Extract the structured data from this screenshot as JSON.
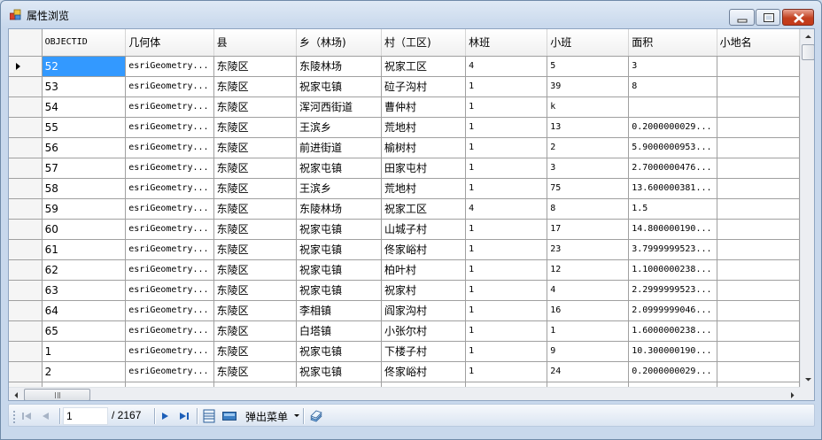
{
  "window": {
    "title": "属性浏览",
    "min_icon": "minimize-icon",
    "max_icon": "maximize-icon",
    "close_icon": "close-icon"
  },
  "grid": {
    "columns": [
      "OBJECTID",
      "几何体",
      "县",
      "乡（林场)",
      "村（工区)",
      "林班",
      "小班",
      "面积",
      "小地名"
    ],
    "selected_row": 0,
    "rows": [
      [
        "52",
        "esriGeometry...",
        "东陵区",
        "东陵林场",
        "祝家工区",
        "4",
        "5",
        "3",
        ""
      ],
      [
        "53",
        "esriGeometry...",
        "东陵区",
        "祝家屯镇",
        "砬子沟村",
        "1",
        "39",
        "8",
        ""
      ],
      [
        "54",
        "esriGeometry...",
        "东陵区",
        "浑河西街道",
        "曹仲村",
        "1",
        "k",
        "",
        ""
      ],
      [
        "55",
        "esriGeometry...",
        "东陵区",
        "王滨乡",
        "荒地村",
        "1",
        "13",
        "0.2000000029...",
        ""
      ],
      [
        "56",
        "esriGeometry...",
        "东陵区",
        "前进街道",
        "榆树村",
        "1",
        "2",
        "5.9000000953...",
        ""
      ],
      [
        "57",
        "esriGeometry...",
        "东陵区",
        "祝家屯镇",
        "田家屯村",
        "1",
        "3",
        "2.7000000476...",
        ""
      ],
      [
        "58",
        "esriGeometry...",
        "东陵区",
        "王滨乡",
        "荒地村",
        "1",
        "75",
        "13.600000381...",
        ""
      ],
      [
        "59",
        "esriGeometry...",
        "东陵区",
        "东陵林场",
        "祝家工区",
        "4",
        "8",
        "1.5",
        ""
      ],
      [
        "60",
        "esriGeometry...",
        "东陵区",
        "祝家屯镇",
        "山城子村",
        "1",
        "17",
        "14.800000190...",
        ""
      ],
      [
        "61",
        "esriGeometry...",
        "东陵区",
        "祝家屯镇",
        "佟家峪村",
        "1",
        "23",
        "3.7999999523...",
        ""
      ],
      [
        "62",
        "esriGeometry...",
        "东陵区",
        "祝家屯镇",
        "柏叶村",
        "1",
        "12",
        "1.1000000238...",
        ""
      ],
      [
        "63",
        "esriGeometry...",
        "东陵区",
        "祝家屯镇",
        "祝家村",
        "1",
        "4",
        "2.2999999523...",
        ""
      ],
      [
        "64",
        "esriGeometry...",
        "东陵区",
        "李相镇",
        "阎家沟村",
        "1",
        "16",
        "2.0999999046...",
        ""
      ],
      [
        "65",
        "esriGeometry...",
        "东陵区",
        "白塔镇",
        "小张尔村",
        "1",
        "1",
        "1.6000000238...",
        ""
      ],
      [
        "1",
        "esriGeometry...",
        "东陵区",
        "祝家屯镇",
        "下楼子村",
        "1",
        "9",
        "10.300000190...",
        ""
      ],
      [
        "2",
        "esriGeometry...",
        "东陵区",
        "祝家屯镇",
        "佟家峪村",
        "1",
        "24",
        "0.2000000029...",
        ""
      ],
      [
        "",
        "",
        "",
        "",
        "",
        "",
        "",
        "",
        ""
      ]
    ]
  },
  "navigator": {
    "position": "1",
    "count_label": "/ 2167",
    "menu_label": "弹出菜单",
    "icons": [
      "first-record-icon",
      "previous-record-icon",
      "next-record-icon",
      "last-record-icon",
      "table-view-icon",
      "form-view-icon",
      "export-icon"
    ]
  }
}
